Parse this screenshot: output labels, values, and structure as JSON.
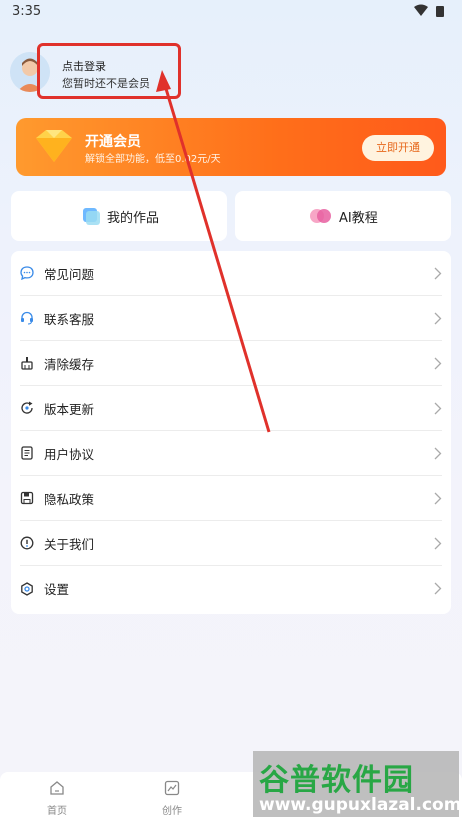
{
  "status": {
    "time": "3:35"
  },
  "profile": {
    "login": "点击登录",
    "member_status": "您暂时还不是会员"
  },
  "vip": {
    "title": "开通会员",
    "subtitle": "解锁全部功能，低至0.02元/天",
    "button": "立即开通"
  },
  "quick": {
    "works": "我的作品",
    "tutorial": "AI教程"
  },
  "menu": {
    "items": [
      {
        "label": "常见问题",
        "icon": "chat-bubble-icon"
      },
      {
        "label": "联系客服",
        "icon": "headset-icon"
      },
      {
        "label": "清除缓存",
        "icon": "broom-icon"
      },
      {
        "label": "版本更新",
        "icon": "refresh-icon"
      },
      {
        "label": "用户协议",
        "icon": "document-icon"
      },
      {
        "label": "隐私政策",
        "icon": "save-icon"
      },
      {
        "label": "关于我们",
        "icon": "info-icon"
      },
      {
        "label": "设置",
        "icon": "settings-icon"
      }
    ]
  },
  "nav": {
    "home": "首页",
    "create": "创作"
  },
  "watermark": {
    "title": "谷普软件园",
    "url": "www.gupuxlazal.com"
  },
  "colors": {
    "accent": "#ff6f1a",
    "highlight": "#e0312b"
  }
}
